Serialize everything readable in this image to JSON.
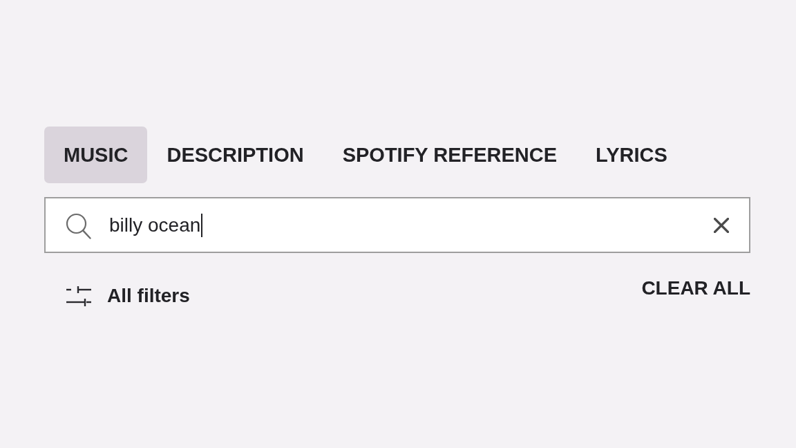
{
  "tabs": [
    {
      "label": "MUSIC",
      "selected": true
    },
    {
      "label": "DESCRIPTION",
      "selected": false
    },
    {
      "label": "SPOTIFY REFERENCE",
      "selected": false
    },
    {
      "label": "LYRICS",
      "selected": false
    }
  ],
  "search": {
    "value": "billy ocean",
    "focused": true
  },
  "filters_button": {
    "label": "All filters"
  },
  "clear_all_button": {
    "label": "CLEAR ALL"
  }
}
